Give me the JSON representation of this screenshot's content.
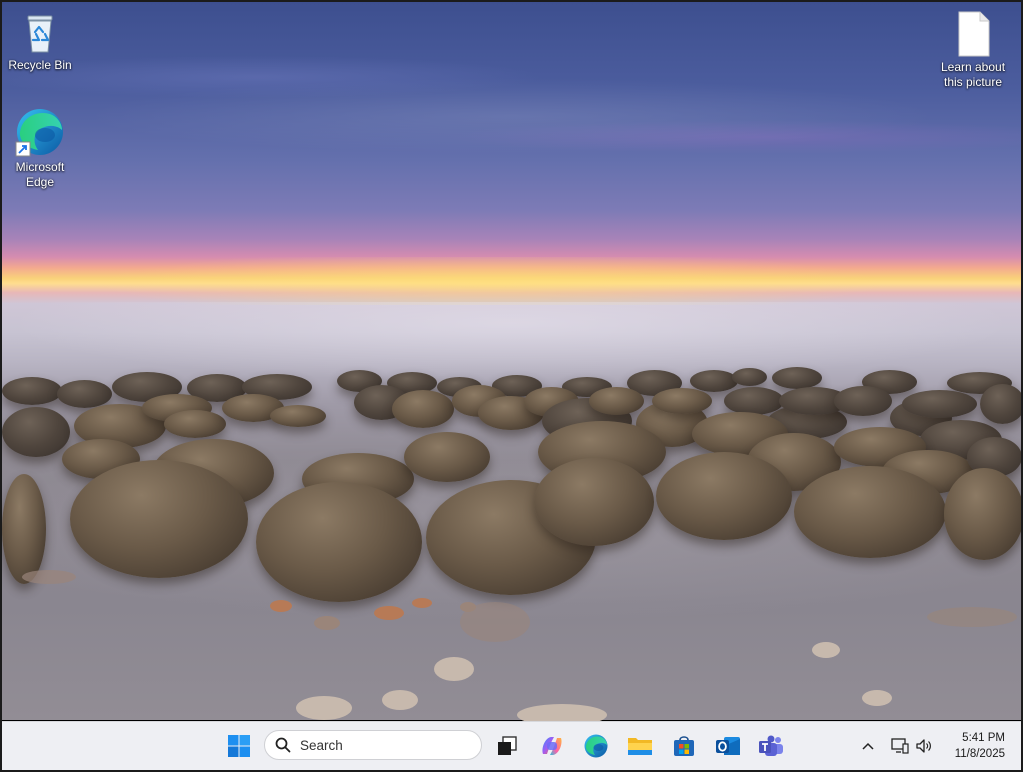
{
  "desktop": {
    "icons": [
      {
        "label": "Recycle Bin",
        "icon": "recycle-bin-icon"
      },
      {
        "label": "Microsoft Edge",
        "icon": "edge-icon"
      },
      {
        "label": "Learn about this picture",
        "icon": "document-icon"
      }
    ]
  },
  "taskbar": {
    "start_icon": "windows-logo-icon",
    "search_placeholder": "Search",
    "apps": [
      {
        "name": "Task View",
        "icon": "task-view-icon"
      },
      {
        "name": "Copilot",
        "icon": "copilot-icon"
      },
      {
        "name": "Microsoft Edge",
        "icon": "edge-icon"
      },
      {
        "name": "File Explorer",
        "icon": "file-explorer-icon"
      },
      {
        "name": "Microsoft Store",
        "icon": "store-icon"
      },
      {
        "name": "Outlook",
        "icon": "outlook-icon"
      },
      {
        "name": "Teams",
        "icon": "teams-icon"
      }
    ],
    "tray": {
      "overflow_icon": "chevron-up-icon",
      "network_icon": "network-icon",
      "volume_icon": "volume-icon"
    },
    "clock": {
      "time": "5:41 PM",
      "date": "11/8/2025"
    }
  },
  "colors": {
    "taskbar_bg": "#eeeff3",
    "windows_blue": "#1a73e8"
  }
}
